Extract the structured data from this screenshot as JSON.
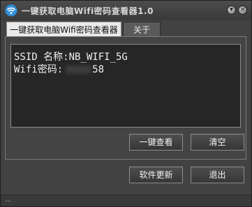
{
  "window": {
    "title": "一键获取电脑Wifi密码查看器1.0",
    "minimize_glyph": "▾",
    "close_glyph": "×"
  },
  "tabs": [
    {
      "label": "一键获取电脑Wifi密码查看器",
      "active": true
    },
    {
      "label": "关于",
      "active": false
    }
  ],
  "output": {
    "ssid_line": "SSID 名称:NB_WIFI_5G",
    "password_prefix": "Wifi密码:",
    "password_visible_suffix": "58"
  },
  "buttons": {
    "view": "一键查看",
    "clear": "清空",
    "update": "软件更新",
    "exit": "退出"
  },
  "status": {
    "dots": "..."
  },
  "colors": {
    "window_bg": "#424242",
    "output_bg": "#262626",
    "text": "#f0f0f0"
  }
}
